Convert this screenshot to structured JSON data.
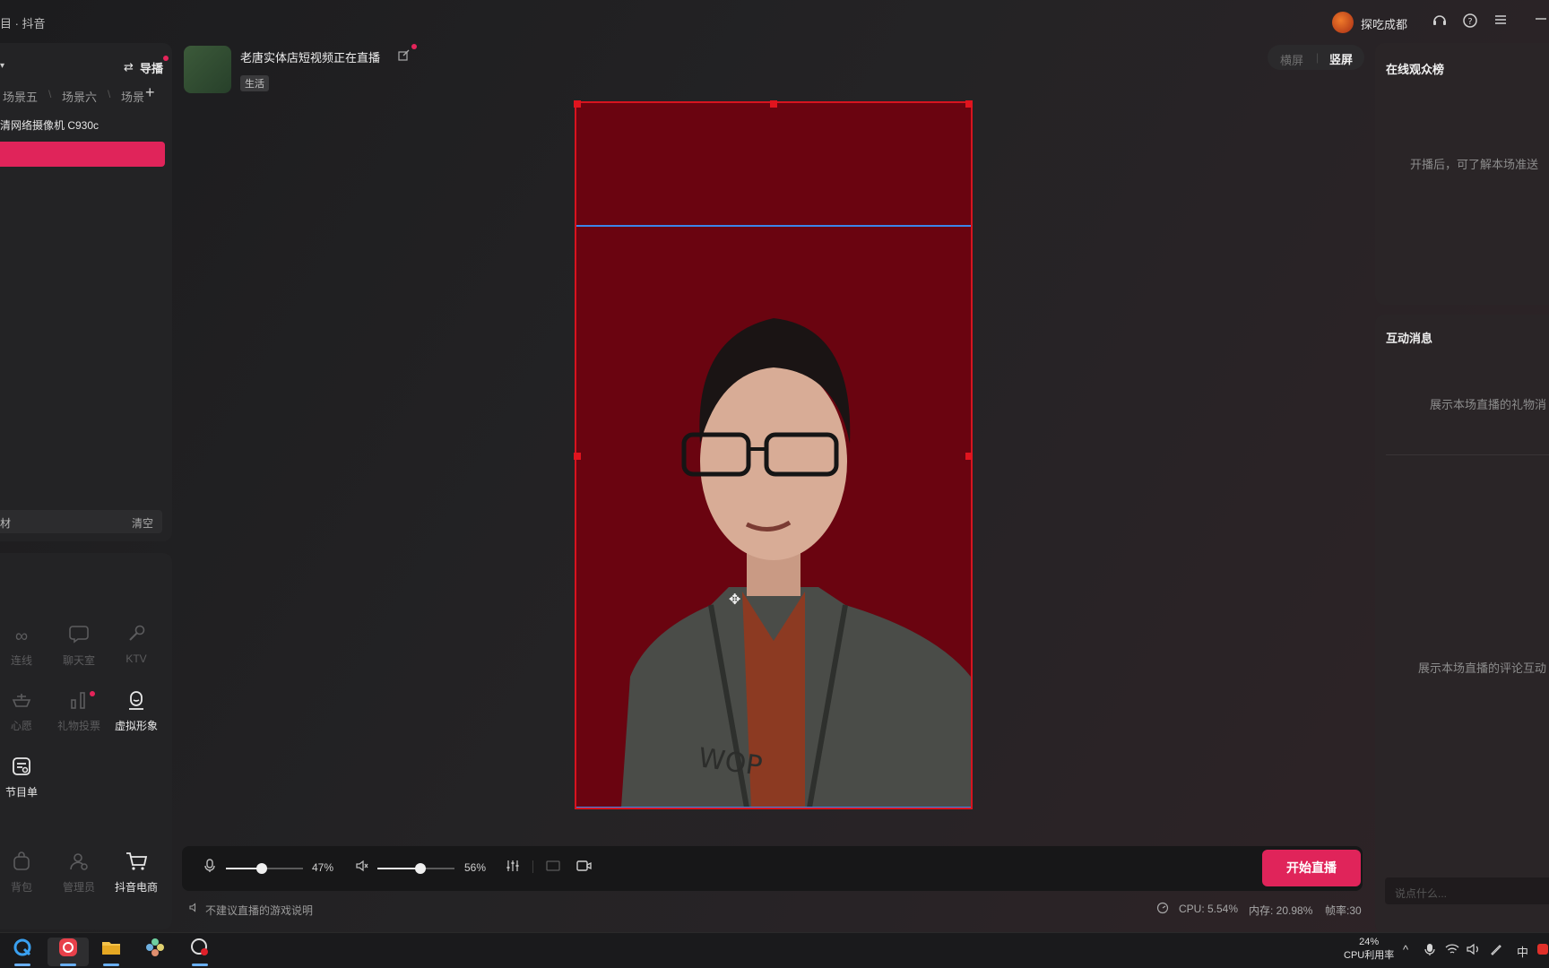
{
  "titlebar": {
    "app_title": "目 · 抖音",
    "user_name": "探吃成都"
  },
  "left_panel": {
    "guide_label": "导播",
    "scenes": [
      "场景五",
      "场景六",
      "场景"
    ],
    "camera_name": "清网络摄像机 C930c",
    "source_label": "材",
    "clear_label": "清空",
    "tools_row1": [
      {
        "icon": "link-icon",
        "label": "连线"
      },
      {
        "icon": "chat-room-icon",
        "label": "聊天室"
      },
      {
        "icon": "microphone-icon",
        "label": "KTV"
      }
    ],
    "tools_row2": [
      {
        "icon": "wish-icon",
        "label": "心愿"
      },
      {
        "icon": "gift-vote-icon",
        "label": "礼物投票"
      },
      {
        "icon": "avatar-icon",
        "label": "虚拟形象"
      }
    ],
    "tools_row3": [
      {
        "icon": "program-list-icon",
        "label": "节目单"
      }
    ],
    "tools_row4": [
      {
        "icon": "bag-icon",
        "label": "背包"
      },
      {
        "icon": "admin-icon",
        "label": "管理员"
      },
      {
        "icon": "cart-icon",
        "label": "抖音电商"
      }
    ]
  },
  "stream": {
    "title": "老唐实体店短视频正在直播",
    "tag": "生活"
  },
  "orientation": {
    "landscape": "横屏",
    "portrait": "竖屏",
    "selected": "portrait"
  },
  "controls": {
    "mic_volume_label": "47%",
    "mic_volume": 0.47,
    "speaker_volume_label": "56%",
    "speaker_volume": 0.56,
    "start_button": "开始直播"
  },
  "status": {
    "warning": "不建议直播的游戏说明",
    "cpu": "CPU: 5.54%",
    "memory": "内存: 20.98%",
    "framerate": "帧率:30"
  },
  "right_panel": {
    "audience_title": "在线观众榜",
    "audience_hint": "开播后，可了解本场准送",
    "messages_title": "互动消息",
    "gift_hint": "展示本场直播的礼物消",
    "comment_hint": "展示本场直播的评论互动",
    "chat_placeholder": "说点什么..."
  },
  "taskbar": {
    "cpu_percent": "24%",
    "cpu_label": "CPU利用率",
    "ime": "中"
  },
  "colors": {
    "accent": "#e0245a",
    "preview_bg": "#6a0410",
    "selection_border": "#d7141f",
    "guide_line": "#3c86e8"
  }
}
